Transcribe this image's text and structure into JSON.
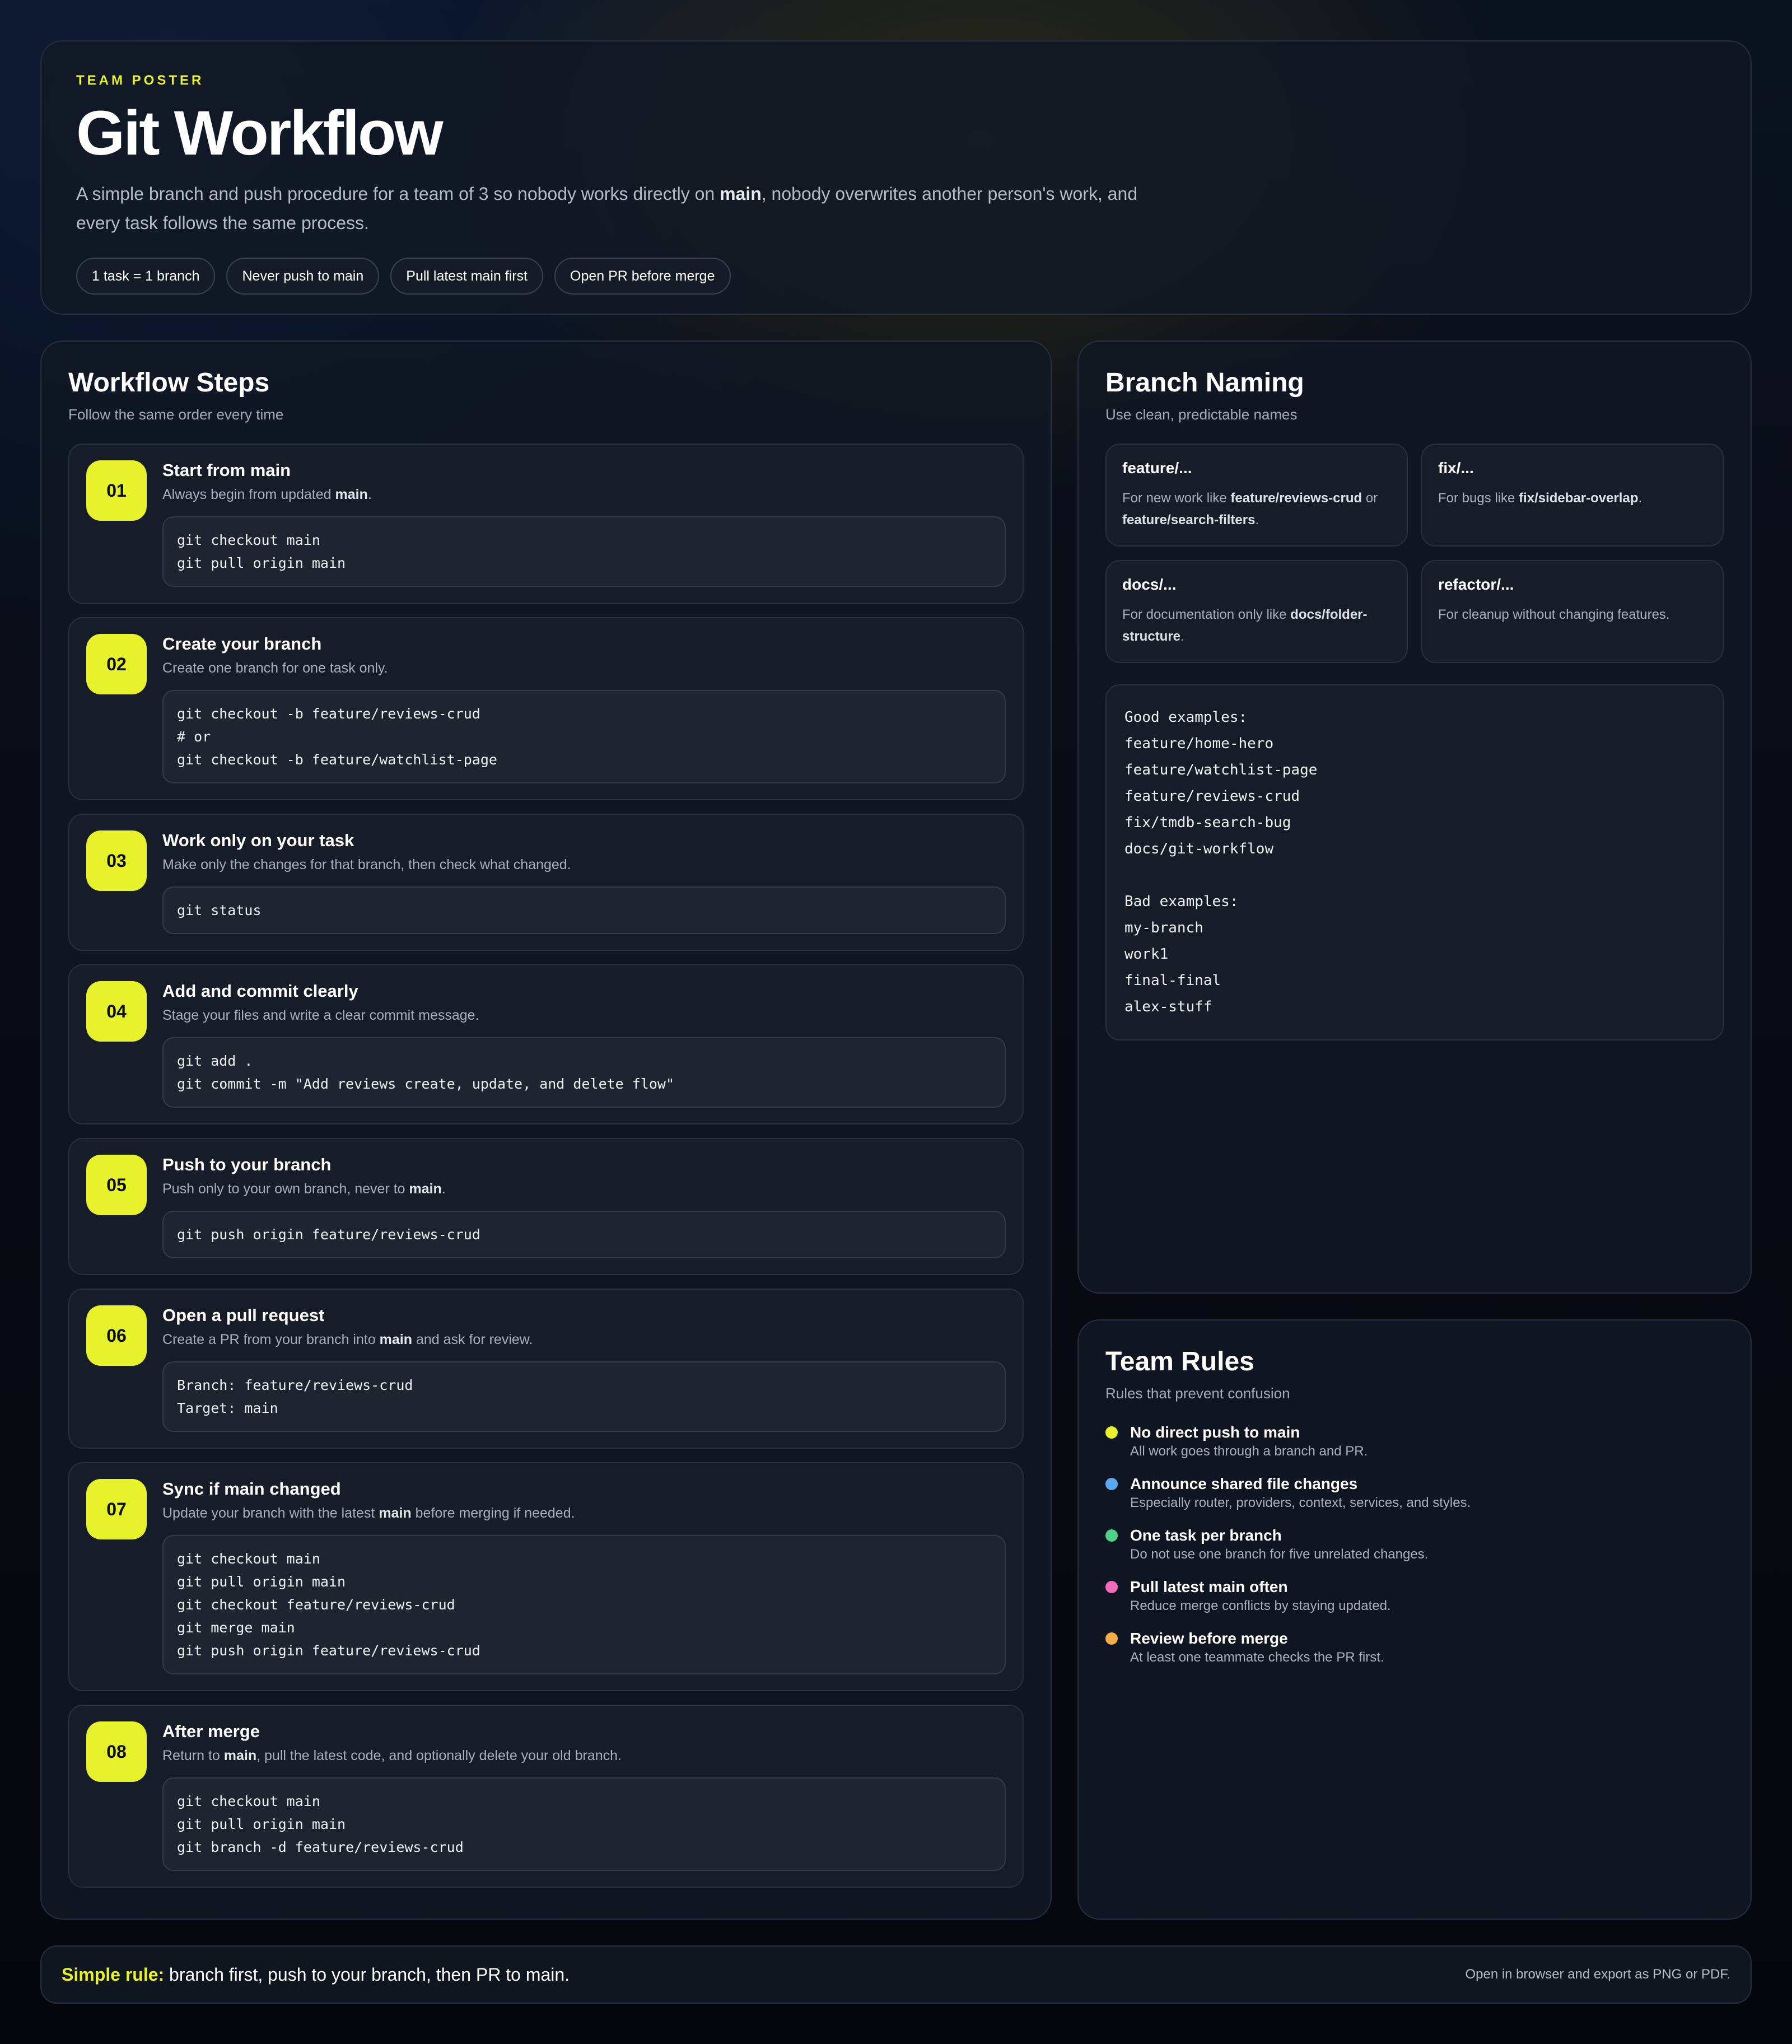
{
  "hero": {
    "eyebrow": "TEAM POSTER",
    "title": "Git Workflow",
    "desc_1": "A simple branch and push procedure for a team of 3 so nobody works directly on ",
    "desc_bold": "main",
    "desc_2": ", nobody overwrites another person's work, and every task follows the same process.",
    "pills": [
      "1 task = 1 branch",
      "Never push to main",
      "Pull latest main first",
      "Open PR before merge"
    ]
  },
  "steps": {
    "title": "Workflow Steps",
    "subtitle": "Follow the same order every time",
    "items": [
      {
        "num": "01",
        "title": "Start from main",
        "desc_1": "Always begin from updated ",
        "bold": "main",
        "desc_2": ".",
        "code": "git checkout main\ngit pull origin main"
      },
      {
        "num": "02",
        "title": "Create your branch",
        "desc_1": "Create one branch for one task only.",
        "bold": "",
        "desc_2": "",
        "code": "git checkout -b feature/reviews-crud\n# or\ngit checkout -b feature/watchlist-page"
      },
      {
        "num": "03",
        "title": "Work only on your task",
        "desc_1": "Make only the changes for that branch, then check what changed.",
        "bold": "",
        "desc_2": "",
        "code": "git status"
      },
      {
        "num": "04",
        "title": "Add and commit clearly",
        "desc_1": "Stage your files and write a clear commit message.",
        "bold": "",
        "desc_2": "",
        "code": "git add .\ngit commit -m \"Add reviews create, update, and delete flow\""
      },
      {
        "num": "05",
        "title": "Push to your branch",
        "desc_1": "Push only to your own branch, never to ",
        "bold": "main",
        "desc_2": ".",
        "code": "git push origin feature/reviews-crud"
      },
      {
        "num": "06",
        "title": "Open a pull request",
        "desc_1": "Create a PR from your branch into ",
        "bold": "main",
        "desc_2": " and ask for review.",
        "code": "Branch: feature/reviews-crud\nTarget: main"
      },
      {
        "num": "07",
        "title": "Sync if main changed",
        "desc_1": "Update your branch with the latest ",
        "bold": "main",
        "desc_2": " before merging if needed.",
        "code": "git checkout main\ngit pull origin main\ngit checkout feature/reviews-crud\ngit merge main\ngit push origin feature/reviews-crud"
      },
      {
        "num": "08",
        "title": "After merge",
        "desc_1": "Return to ",
        "bold": "main",
        "desc_2": ", pull the latest code, and optionally delete your old branch.",
        "code": "git checkout main\ngit pull origin main\ngit branch -d feature/reviews-crud"
      }
    ]
  },
  "naming": {
    "title": "Branch Naming",
    "subtitle": "Use clean, predictable names",
    "items": [
      {
        "title": "feature/...",
        "desc_1": "For new work like ",
        "bold_1": "feature/reviews-crud",
        "desc_2": " or ",
        "bold_2": "feature/search-filters",
        "desc_3": "."
      },
      {
        "title": "fix/...",
        "desc_1": "For bugs like ",
        "bold_1": "fix/sidebar-overlap",
        "desc_2": ".",
        "bold_2": "",
        "desc_3": ""
      },
      {
        "title": "docs/...",
        "desc_1": "For documentation only like ",
        "bold_1": "docs/folder-structure",
        "desc_2": ".",
        "bold_2": "",
        "desc_3": ""
      },
      {
        "title": "refactor/...",
        "desc_1": "For cleanup without changing features.",
        "bold_1": "",
        "desc_2": "",
        "bold_2": "",
        "desc_3": ""
      }
    ],
    "examples": "Good examples:\nfeature/home-hero\nfeature/watchlist-page\nfeature/reviews-crud\nfix/tmdb-search-bug\ndocs/git-workflow\n\nBad examples:\nmy-branch\nwork1\nfinal-final\nalex-stuff"
  },
  "rules": {
    "title": "Team Rules",
    "subtitle": "Rules that prevent confusion",
    "items": [
      {
        "title": "No direct push to main",
        "desc": "All work goes through a branch and PR.",
        "color": "#e8f22b"
      },
      {
        "title": "Announce shared file changes",
        "desc": "Especially router, providers, context, services, and styles.",
        "color": "#5aa9f0"
      },
      {
        "title": "One task per branch",
        "desc": "Do not use one branch for five unrelated changes.",
        "color": "#4fd18b"
      },
      {
        "title": "Pull latest main often",
        "desc": "Reduce merge conflicts by staying updated.",
        "color": "#f06bb8"
      },
      {
        "title": "Review before merge",
        "desc": "At least one teammate checks the PR first.",
        "color": "#f5ad45"
      }
    ]
  },
  "footer": {
    "label": "Simple rule:",
    "text": " branch first, push to your branch, then PR to main.",
    "note": "Open in browser and export as PNG or PDF."
  }
}
